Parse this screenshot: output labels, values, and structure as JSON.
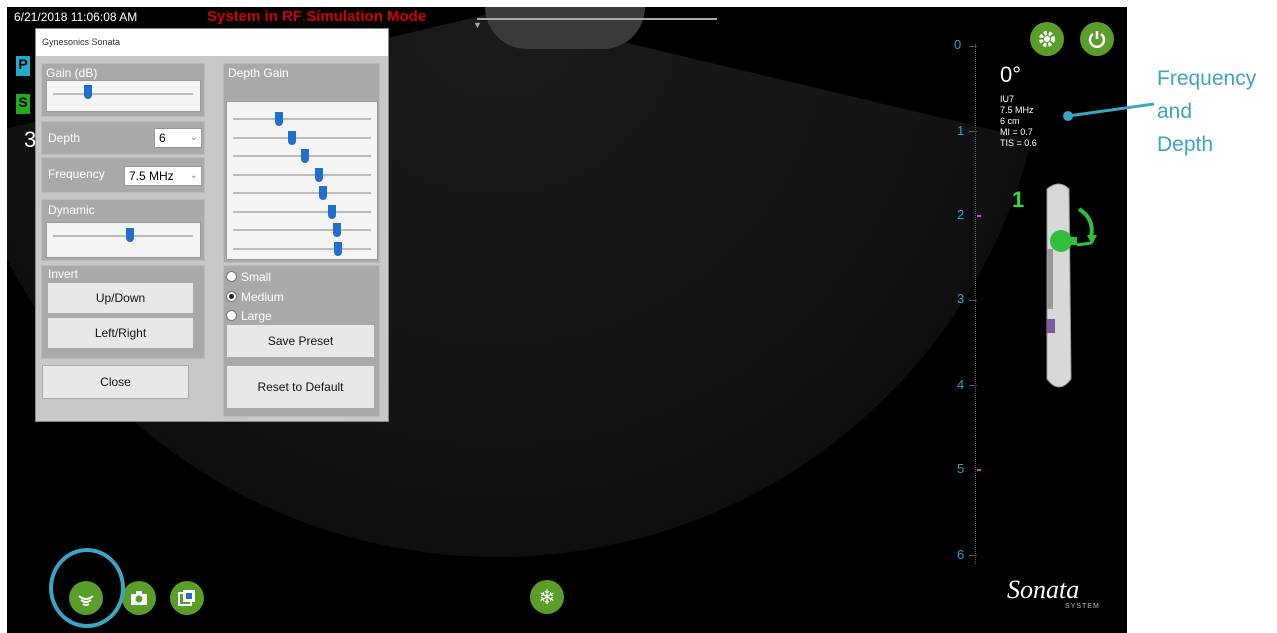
{
  "status_bar": {
    "datetime": "6/21/2018 11:06:08 AM",
    "mode_message": "System in RF Simulation Mode",
    "mode_color": "#d00000"
  },
  "left_indicators": {
    "badge1": "P",
    "badge2": "S",
    "value": "3"
  },
  "dialog": {
    "title": "Gynesonics Sonata",
    "gain_label": "Gain (dB)",
    "gain_level": 0.25,
    "depth_label": "Depth",
    "depth_value": "6",
    "frequency_label": "Frequency",
    "frequency_value": "7.5 MHz",
    "dynamic_label": "Dynamic",
    "dynamic_level": 0.55,
    "invert_label": "Invert",
    "updown_button": "Up/Down",
    "leftright_button": "Left/Right",
    "close_button": "Close",
    "depth_gain_label": "Depth Gain",
    "depth_gain_levels": [
      0.33,
      0.43,
      0.52,
      0.62,
      0.65,
      0.72,
      0.75,
      0.76
    ],
    "size_options": [
      "Small",
      "Medium",
      "Large"
    ],
    "size_selected": "Medium",
    "save_preset_button": "Save Preset",
    "reset_button": "Reset to Default"
  },
  "depth_scale": {
    "labels": [
      "0",
      "1",
      "2",
      "3",
      "4",
      "5",
      "6"
    ],
    "accent_color": "#2a9fd6"
  },
  "probe_info": {
    "angle": "0°",
    "lines": [
      "IU7",
      "7.5 MHz",
      "6 cm",
      "MI = 0.7",
      "TIS = 0.6"
    ],
    "probe_number": "1"
  },
  "toolbar": {
    "icons": [
      "ultrasound-waves-icon",
      "camera-icon",
      "image-gallery-icon",
      "freeze-snowflake-icon",
      "settings-gear-icon",
      "power-icon"
    ],
    "button_color": "#5a9e2a"
  },
  "brand": {
    "name": "Sonata",
    "subtitle": "SYSTEM"
  },
  "annotation": {
    "lines": [
      "Frequency",
      "and",
      "Depth"
    ],
    "color": "#3aa6c4"
  }
}
